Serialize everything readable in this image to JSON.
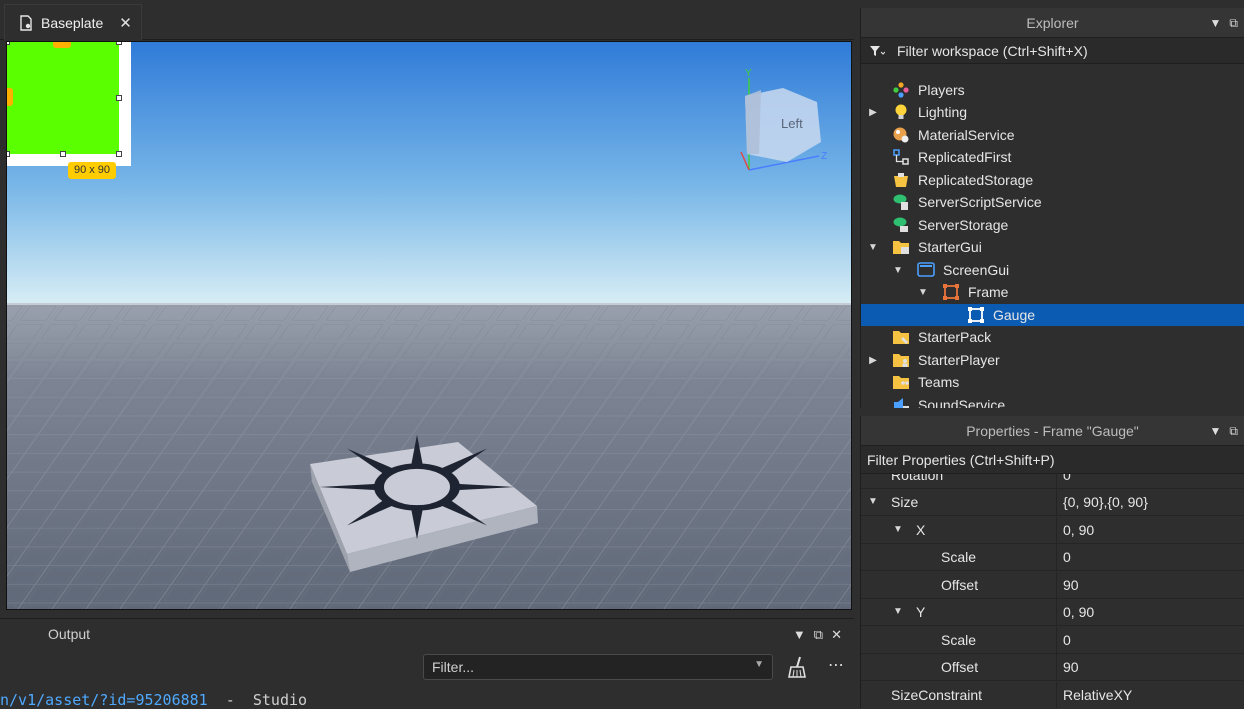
{
  "tabs": [
    {
      "label": "Baseplate",
      "close": "✕"
    }
  ],
  "viewport": {
    "size_badge": "90 x 90",
    "view_cube": {
      "face_label": "Left",
      "axis_y": "Y",
      "axis_z": "Z"
    },
    "colors": {
      "sky_top": "#2f7bd8",
      "sky_horizon": "#d9eef5",
      "ground": "#6d7585",
      "gauge_frame": "#5aff00"
    }
  },
  "output": {
    "title": "Output",
    "filter_placeholder": "Filter...",
    "line_link": "n/v1/asset/?id=95206881",
    "line_sep": "  -  Studio"
  },
  "explorer": {
    "title": "Explorer",
    "filter_placeholder": "Filter workspace (Ctrl+Shift+X)",
    "items": [
      {
        "label": "Players",
        "icon": "players-icon",
        "arrow": ""
      },
      {
        "label": "Lighting",
        "icon": "lighting-icon",
        "arrow": "▶"
      },
      {
        "label": "MaterialService",
        "icon": "material-service-icon",
        "arrow": ""
      },
      {
        "label": "ReplicatedFirst",
        "icon": "replicated-first-icon",
        "arrow": ""
      },
      {
        "label": "ReplicatedStorage",
        "icon": "replicated-storage-icon",
        "arrow": ""
      },
      {
        "label": "ServerScriptService",
        "icon": "server-script-service-icon",
        "arrow": ""
      },
      {
        "label": "ServerStorage",
        "icon": "server-storage-icon",
        "arrow": ""
      },
      {
        "label": "StarterGui",
        "icon": "starter-gui-icon",
        "arrow": "▼"
      },
      {
        "label": "ScreenGui",
        "icon": "screen-gui-icon",
        "arrow": "▼"
      },
      {
        "label": "Frame",
        "icon": "frame-icon",
        "arrow": "▼"
      },
      {
        "label": "Gauge",
        "icon": "frame-icon",
        "arrow": ""
      },
      {
        "label": "StarterPack",
        "icon": "starter-pack-icon",
        "arrow": ""
      },
      {
        "label": "StarterPlayer",
        "icon": "starter-player-icon",
        "arrow": "▶"
      },
      {
        "label": "Teams",
        "icon": "teams-icon",
        "arrow": ""
      },
      {
        "label": "SoundService",
        "icon": "sound-service-icon",
        "arrow": ""
      }
    ],
    "selected": "Gauge"
  },
  "properties": {
    "title": "Properties - Frame \"Gauge\"",
    "filter_placeholder": "Filter Properties (Ctrl+Shift+P)",
    "rows": [
      {
        "name": "Rotation",
        "value": "0",
        "arrow": ""
      },
      {
        "name": "Size",
        "value": "{0, 90},{0, 90}",
        "arrow": "▼"
      },
      {
        "name": "X",
        "value": "0, 90",
        "arrow": "▼"
      },
      {
        "name": "Scale",
        "value": "0",
        "arrow": ""
      },
      {
        "name": "Offset",
        "value": "90",
        "arrow": ""
      },
      {
        "name": "Y",
        "value": "0, 90",
        "arrow": "▼"
      },
      {
        "name": "Scale",
        "value": "0",
        "arrow": ""
      },
      {
        "name": "Offset",
        "value": "90",
        "arrow": ""
      },
      {
        "name": "SizeConstraint",
        "value": "RelativeXY",
        "arrow": ""
      }
    ]
  }
}
